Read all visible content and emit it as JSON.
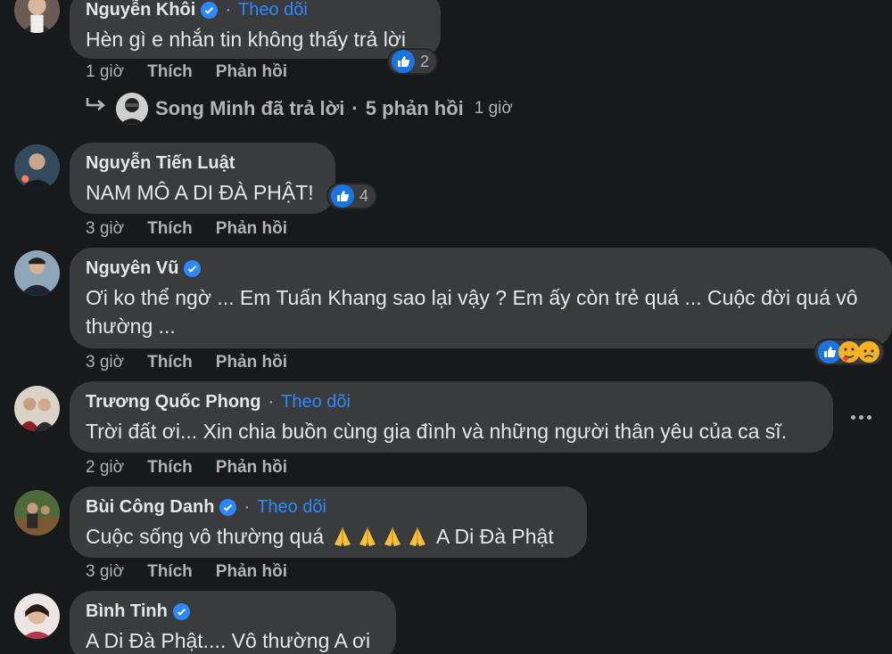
{
  "comments": [
    {
      "name": "Nguyễn Khôi",
      "verified": true,
      "follow": "Theo dõi",
      "text": "Hèn gì e nhắn tin không thấy trả lời",
      "time": "1 giờ",
      "like": "Thích",
      "reply": "Phản hồi",
      "reaction_count": "2",
      "reactions": [
        "like"
      ]
    },
    {
      "name": "Nguyễn Tiến Luật",
      "text": "NAM MÔ A DI ĐÀ PHẬT!",
      "time": "3 giờ",
      "like": "Thích",
      "reply": "Phản hồi",
      "reaction_count": "4",
      "reactions": [
        "like"
      ]
    },
    {
      "name": "Nguyên Vũ",
      "verified": true,
      "text": "Ơi ko thể ngờ ... Em Tuấn Khang sao lại vậy ? Em ấy còn trẻ quá ... Cuộc đời quá vô thường ...",
      "time": "3 giờ",
      "like": "Thích",
      "reply": "Phản hồi",
      "reactions": [
        "like",
        "care",
        "sad"
      ]
    },
    {
      "name": "Trương Quốc Phong",
      "follow": "Theo dõi",
      "text": "Trời đất ơi... Xin chia buồn cùng gia đình và những người thân yêu của ca sĩ.",
      "time": "2 giờ",
      "like": "Thích",
      "reply": "Phản hồi"
    },
    {
      "name": "Bùi Công Danh",
      "verified": true,
      "follow": "Theo dõi",
      "text": "Cuộc sống vô thường quá",
      "text_suffix": "A Di Đà Phật",
      "time": "3 giờ",
      "like": "Thích",
      "reply": "Phản hồi"
    },
    {
      "name": "Bình Tinh",
      "verified": true,
      "text": "A Di Đà Phật.... Vô thường A ơi"
    }
  ],
  "reply_thread": {
    "author": "Song Minh",
    "summary": "Song Minh đã trả lời",
    "count": "5 phản hồi",
    "time": "1 giờ"
  },
  "icons": {
    "like": "like-icon",
    "care": "care-icon",
    "sad": "sad-icon",
    "reply_arrow": "reply-arrow-icon",
    "verified": "verified-badge-icon",
    "more": "more-options-icon",
    "pray": "folded-hands-emoji"
  },
  "colors": {
    "background": "#18191a",
    "bubble": "#3a3b3c",
    "link_blue": "#2d88ff",
    "secondary_text": "#b0b3b8"
  }
}
